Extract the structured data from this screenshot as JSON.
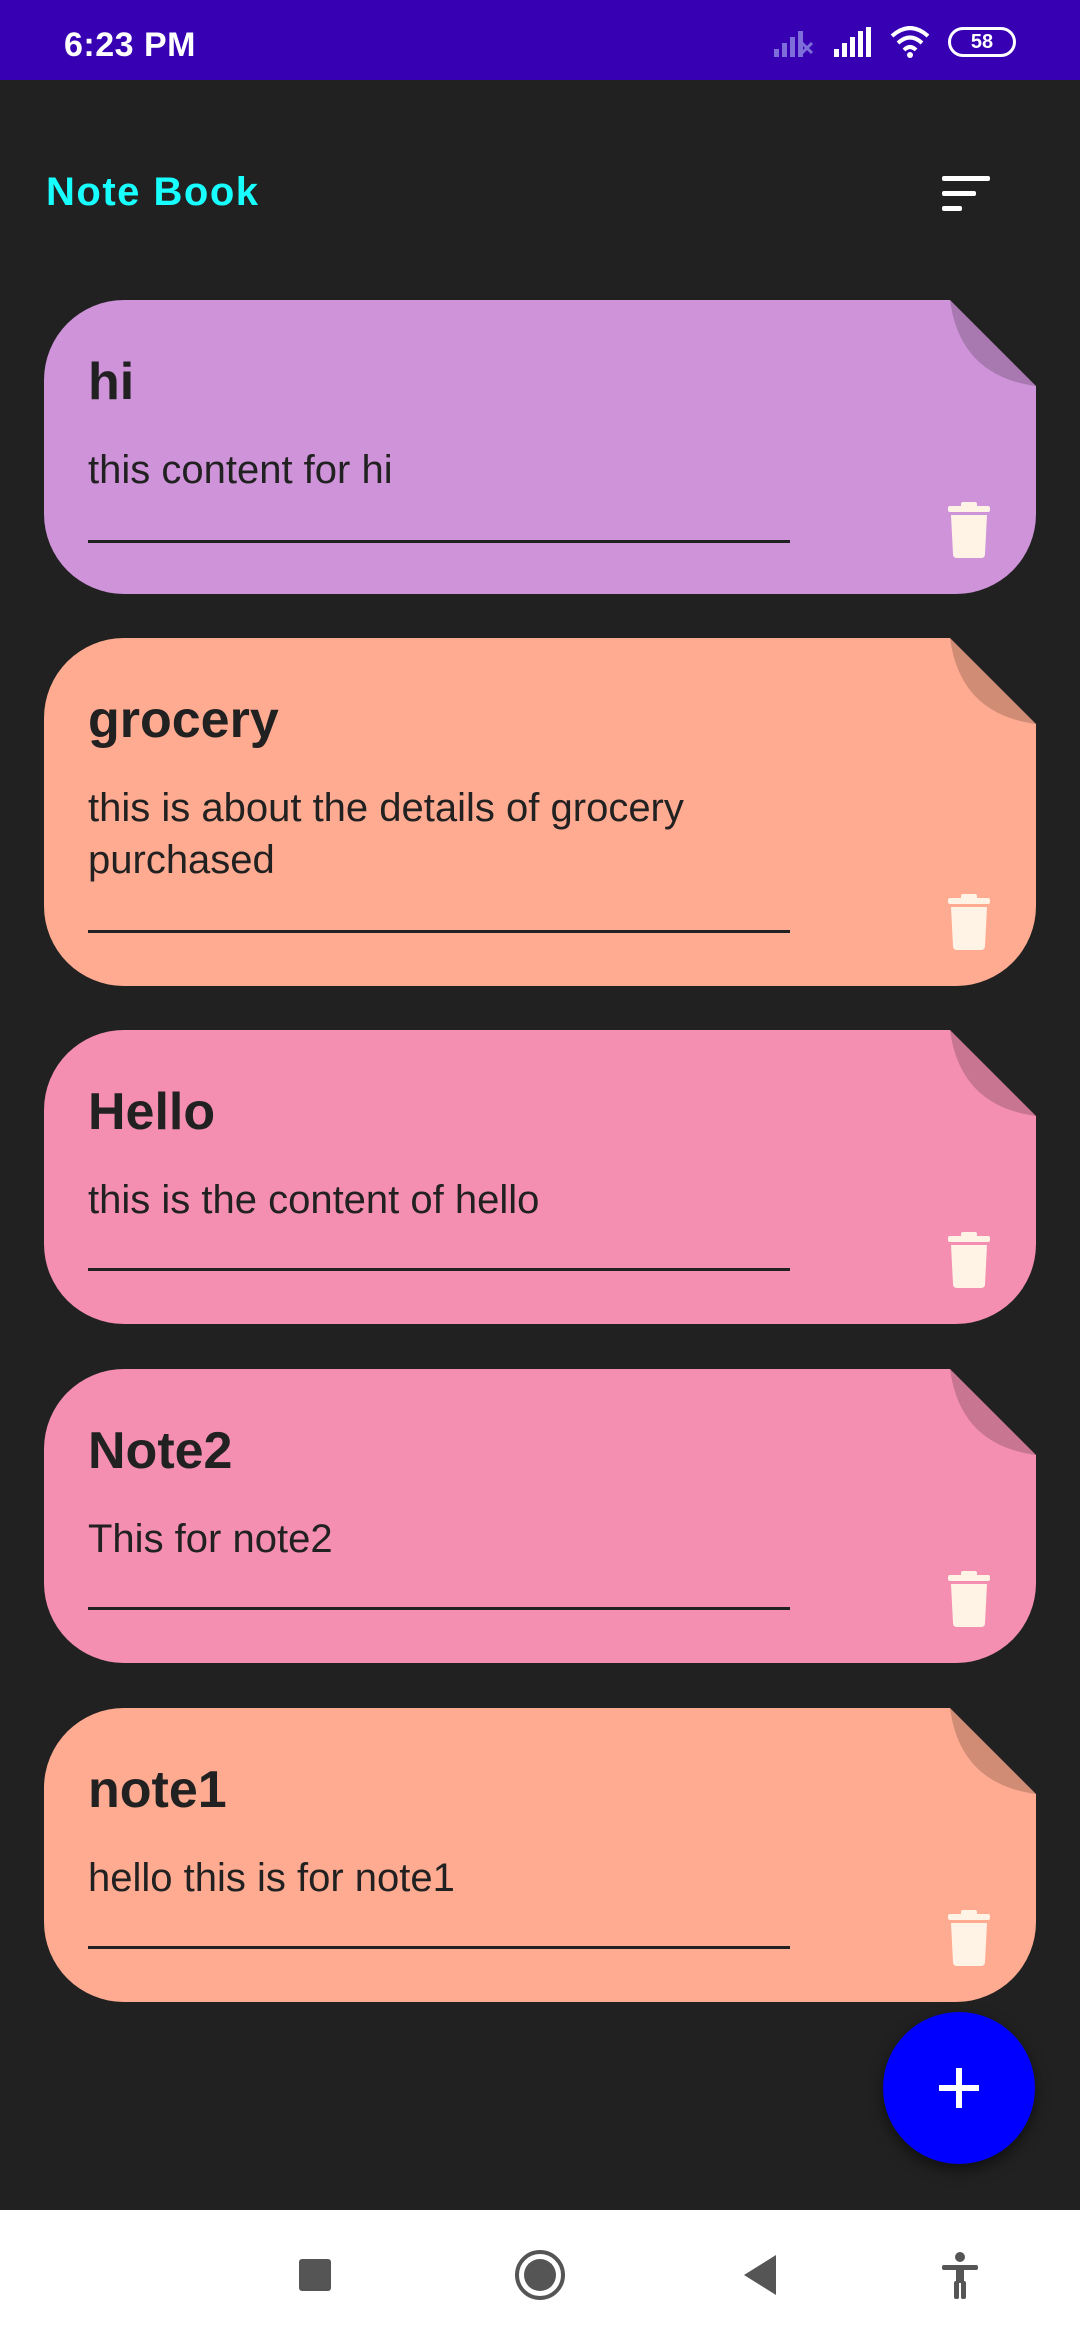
{
  "status_bar": {
    "time": "6:23 PM",
    "battery": "58",
    "icons": [
      "signal-off-icon",
      "signal-icon",
      "wifi-icon",
      "battery-icon"
    ]
  },
  "app_bar": {
    "title": "Note Book",
    "title_color": "#18ffff",
    "sort_icon": "sort-icon"
  },
  "notes": [
    {
      "title": "hi",
      "content": "this content for hi",
      "color": "#ce93d8"
    },
    {
      "title": "grocery",
      "content": "this is about the details of grocery purchased",
      "color": "#ffab91"
    },
    {
      "title": "Hello",
      "content": "this is the content of hello",
      "color": "#f48fb1"
    },
    {
      "title": "Note2",
      "content": "This for note2",
      "color": "#f48fb1"
    },
    {
      "title": "note1",
      "content": "hello this is for note1",
      "color": "#ffab91"
    }
  ],
  "fab": {
    "icon": "plus-icon",
    "color": "#0000ff"
  },
  "nav_bar": {
    "icons": [
      "recent-apps-icon",
      "home-icon",
      "back-icon",
      "accessibility-icon"
    ]
  }
}
